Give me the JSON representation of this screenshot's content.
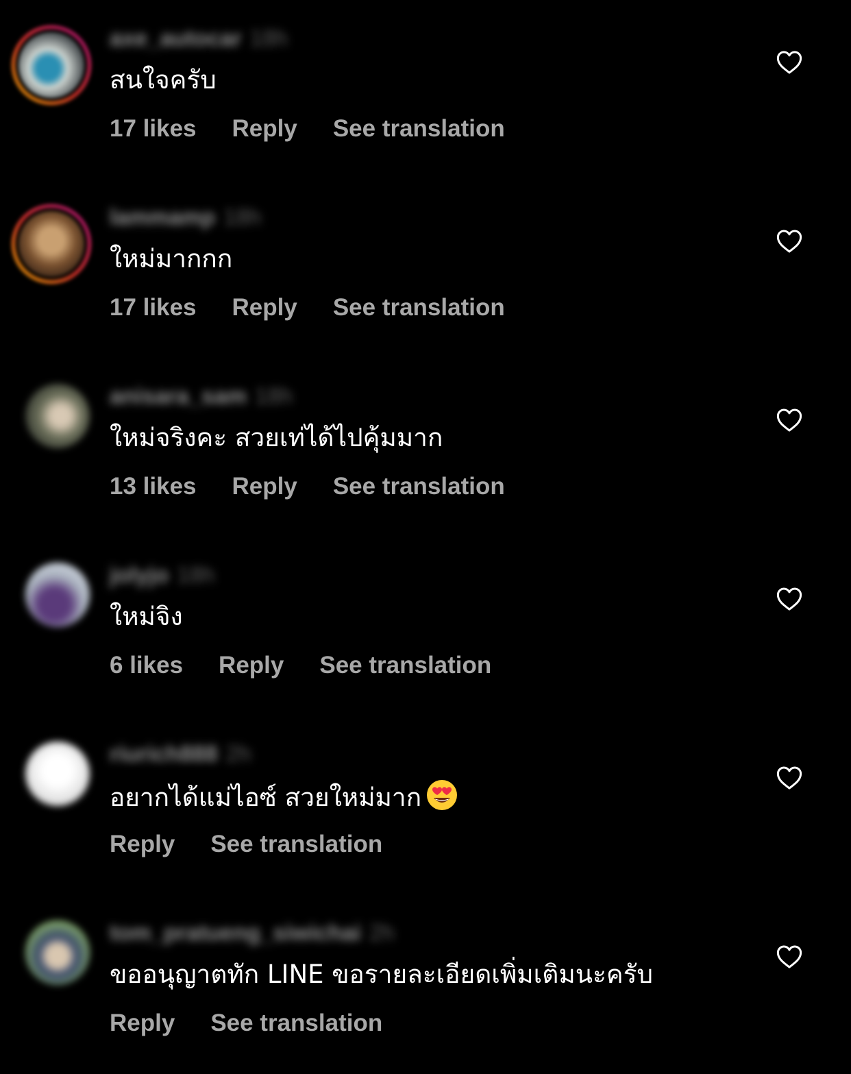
{
  "colors": {
    "background": "#000000",
    "username": "#8e8e8e",
    "action_text": "#a8a8a8",
    "comment_text": "#ffffff",
    "heart_outline": "#ffffff"
  },
  "comments": [
    {
      "username": "axe_autocar",
      "time": "18h",
      "text": "สนใจครับ",
      "likes": "17 likes",
      "reply": "Reply",
      "translate": "See translation",
      "avatar_colors": [
        "#4a4f52",
        "#2a8fb3",
        "#c9d0cc"
      ]
    },
    {
      "username": "lammamp",
      "time": "18h",
      "text": "ใหม่มากกก",
      "likes": "17 likes",
      "reply": "Reply",
      "translate": "See translation",
      "avatar_colors": [
        "#7a5230",
        "#c9a071",
        "#3a2416"
      ]
    },
    {
      "username": "anisara_sam",
      "time": "18h",
      "text": "ใหม่จริงคะ สวยเท่ได้ไปคุ้มมาก",
      "likes": "13 likes",
      "reply": "Reply",
      "translate": "See translation",
      "avatar_colors": [
        "#3b3f35",
        "#d8c9b4",
        "#6b6f5a"
      ]
    },
    {
      "username": "jolyjo",
      "time": "18h",
      "text": "ใหม่จิง",
      "likes": "6 likes",
      "reply": "Reply",
      "translate": "See translation",
      "avatar_colors": [
        "#cfd6df",
        "#5a3a7a",
        "#a8b0bd"
      ]
    },
    {
      "username": "riurich888",
      "time": "2h",
      "text": "อยากได้แม่ไอซ์ สวยใหม่มาก",
      "emoji": "heart-eyes-emoji",
      "likes": "",
      "reply": "Reply",
      "translate": "See translation",
      "avatar_colors": [
        "#e8e8e8",
        "#ffffff",
        "#d0d0d0"
      ]
    },
    {
      "username": "tom_pratueng_siwichai",
      "time": "2h",
      "text": "ขออนุญาตทัก LINE ขอรายละเอียดเพิ่มเติมนะครับ",
      "likes": "",
      "reply": "Reply",
      "translate": "See translation",
      "avatar_colors": [
        "#7fa36a",
        "#d9c7b0",
        "#3a4a6a"
      ]
    }
  ]
}
